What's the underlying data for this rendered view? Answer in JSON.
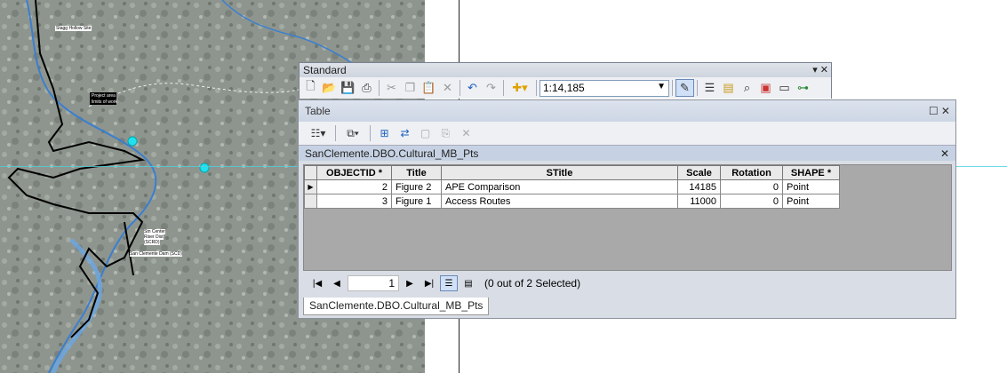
{
  "map": {
    "labels": {
      "staging": "Stagg Hollow Site",
      "project_area_1": "Project area",
      "project_area_2": "limits of work",
      "stn_1": "Stn Center",
      "stn_2": "Riser Dist",
      "stn_3": "(SCRD)",
      "clemente": "San Clemente Dam (SCD)"
    },
    "accent_color": "#4fd0e0"
  },
  "standard_toolbar": {
    "title": "Standard",
    "controls": "▾ ✕",
    "scale_value": "1:14,185",
    "icons": [
      "new-document-icon",
      "open-folder-icon",
      "save-icon",
      "print-icon",
      "cut-icon",
      "copy-icon",
      "paste-icon",
      "delete-icon",
      "undo-icon",
      "redo-icon",
      "add-data-icon",
      "editor-toolbar-icon",
      "table-of-contents-icon",
      "catalog-icon",
      "search-window-icon",
      "arctoolbox-icon",
      "python-window-icon",
      "model-builder-icon"
    ]
  },
  "table_window": {
    "title": "Table",
    "controls": "☐ ✕",
    "table_tab_name": "SanClemente.DBO.Cultural_MB_Pts",
    "columns": [
      "OBJECTID *",
      "Title",
      "STitle",
      "Scale",
      "Rotation",
      "SHAPE *"
    ],
    "rows": [
      {
        "OBJECTID": "2",
        "Title": "Figure 2",
        "STitle": "APE Comparison",
        "Scale": "14185",
        "Rotation": "0",
        "SHAPE": "Point"
      },
      {
        "OBJECTID": "3",
        "Title": "Figure 1",
        "STitle": "Access Routes",
        "Scale": "11000",
        "Rotation": "0",
        "SHAPE": "Point"
      }
    ],
    "nav": {
      "current_record": "1",
      "selection_status": "(0 out of 2 Selected)"
    },
    "bottom_tab": "SanClemente.DBO.Cultural_MB_Pts"
  }
}
